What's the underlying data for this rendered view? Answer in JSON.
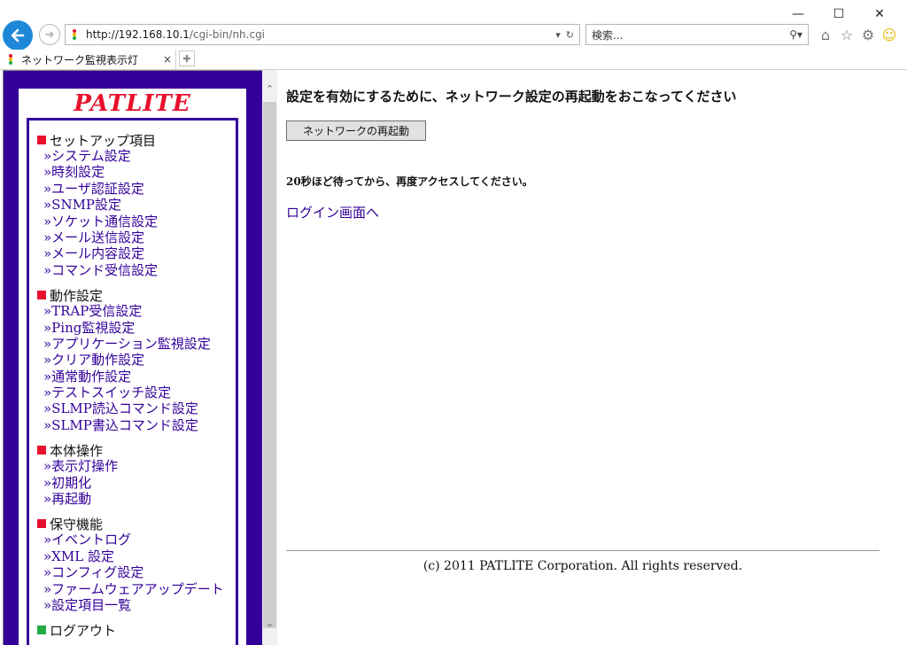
{
  "browser": {
    "url_host": "http://192.168.10.1",
    "url_path": "/cgi-bin/nh.cgi",
    "search_placeholder": "検索...",
    "tab_title": "ネットワーク監視表示灯",
    "tab_close": "×"
  },
  "sidebar": {
    "logo": "PATLITE",
    "sections": [
      {
        "title": "セットアップ項目",
        "color": "#e8112d",
        "items": [
          "»システム設定",
          "»時刻設定",
          "»ユーザ認証設定",
          "»SNMP設定",
          "»ソケット通信設定",
          "»メール送信設定",
          "»メール内容設定",
          "»コマンド受信設定"
        ]
      },
      {
        "title": "動作設定",
        "color": "#e8112d",
        "items": [
          "»TRAP受信設定",
          "»Ping監視設定",
          "»アプリケーション監視設定",
          "»クリア動作設定",
          "»通常動作設定",
          "»テストスイッチ設定",
          "»SLMP読込コマンド設定",
          "»SLMP書込コマンド設定"
        ]
      },
      {
        "title": "本体操作",
        "color": "#e8112d",
        "items": [
          "»表示灯操作",
          "»初期化",
          "»再起動"
        ]
      },
      {
        "title": "保守機能",
        "color": "#e8112d",
        "items": [
          "»イベントログ",
          "»XML 設定",
          "»コンフィグ設定",
          "»ファームウェアアップデート",
          "»設定項目一覧"
        ]
      },
      {
        "title": "ログアウト",
        "color": "#22aa44",
        "items": []
      }
    ]
  },
  "main": {
    "message": "設定を有効にするために、ネットワーク設定の再起動をおこなってください",
    "restart_button": "ネットワークの再起動",
    "wait_text": "20秒ほど待ってから、再度アクセスしてください。",
    "login_link": "ログイン画面へ",
    "copyright": "(c) 2011 PATLITE Corporation. All rights reserved."
  },
  "colors": {
    "frame": "#330099",
    "accent": "#e8112d",
    "link": "#330099"
  }
}
